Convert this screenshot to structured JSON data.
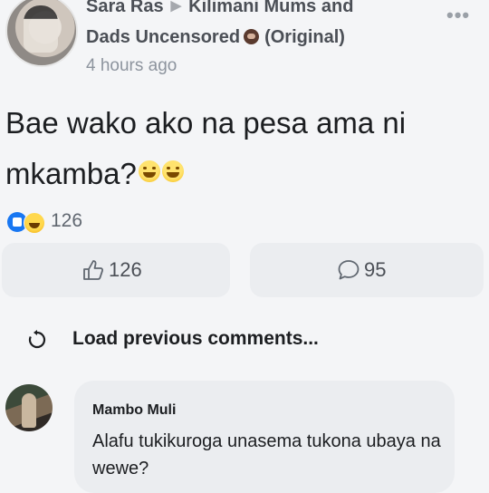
{
  "post": {
    "author": "Sara Ras",
    "group": "Kilimani Mums and",
    "group_line2": "Dads Uncensored",
    "group_suffix": "(Original)",
    "timestamp": "4 hours ago",
    "text_line1": "Bae wako ako na pesa ama ni",
    "text_line2": "mkamba?",
    "reaction_count": "126",
    "like_count": "126",
    "comment_count": "95",
    "icons": {
      "more": "more-options-icon",
      "like": "thumbs-up-icon",
      "comment": "speech-bubble-icon",
      "reactions": [
        "like-reaction-icon",
        "haha-reaction-icon"
      ],
      "emoji": "grinning-sweat-emoji"
    }
  },
  "comments": {
    "load_previous": "Load previous comments...",
    "items": [
      {
        "author": "Mambo Muli",
        "text": "Alafu tukikuroga unasema tukona ubaya na wewe?"
      }
    ]
  },
  "colors": {
    "background": "#f4f5f7",
    "button_bg": "#ebedf0",
    "like_blue": "#1877f2",
    "secondary_text": "#8d949e"
  }
}
